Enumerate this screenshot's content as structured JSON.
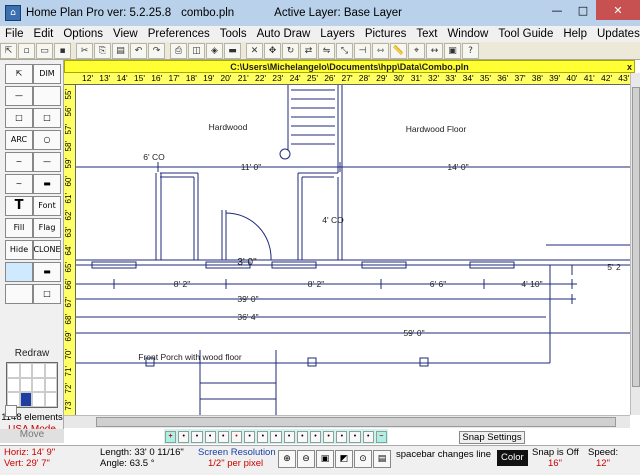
{
  "window": {
    "app_title": "Home Plan Pro ver: 5.2.25.8",
    "file_name": "combo.pln",
    "active_layer": "Active Layer: Base Layer",
    "minimize": "—",
    "maximize": "□",
    "close": "✕"
  },
  "menu": [
    "File",
    "Edit",
    "Options",
    "View",
    "Preferences",
    "Tools",
    "Auto Draw",
    "Layers",
    "Pictures",
    "Text",
    "Window",
    "Tool Guide",
    "Help",
    "Updates"
  ],
  "toolbar": {
    "icons": [
      "cursor-icon",
      "new-file-icon",
      "open-file-icon",
      "save-icon",
      "cut-icon",
      "copy-icon",
      "paste-icon",
      "undo-icon",
      "redo-icon",
      "print-icon",
      "zoom-window-icon",
      "zoom-extents-icon",
      "save-red-icon",
      "delete-icon",
      "move-icon",
      "rotate-icon",
      "flip-icon",
      "mirror-icon",
      "scale-icon",
      "extend-icon",
      "stretch-icon",
      "measure-icon",
      "snap-icon",
      "dimension-icon",
      "block-icon",
      "help-icon"
    ]
  },
  "path": "C:\\Users\\Michelangelo\\Documents\\hpp\\Data\\Combo.pln",
  "ruler_top": [
    "12'",
    "13'",
    "14'",
    "15'",
    "16'",
    "17'",
    "18'",
    "19'",
    "20'",
    "21'",
    "22'",
    "23'",
    "24'",
    "25'",
    "26'",
    "27'",
    "28'",
    "29'",
    "30'",
    "31'",
    "32'",
    "33'",
    "34'",
    "35'",
    "36'",
    "37'",
    "38'",
    "39'",
    "40'",
    "41'",
    "42'",
    "43'"
  ],
  "ruler_left": [
    "55'",
    "56'",
    "57'",
    "58'",
    "59'",
    "60'",
    "61'",
    "62'",
    "63'",
    "64'",
    "65'",
    "66'",
    "67'",
    "68'",
    "69'",
    "70'",
    "71'",
    "72'",
    "73'"
  ],
  "drawing": {
    "hardwood": "Hardwood",
    "hardwood_floor": "Hardwood Floor",
    "co_6": "6' CO",
    "dim_11": "11' 0\"",
    "dim_14": "14' 0\"",
    "co_4": "4' CO",
    "door_dim": "3' 0\"",
    "dim_8_2a": "8' 2\"",
    "dim_8_2b": "8' 2\"",
    "dim_6_6": "6' 6\"",
    "dim_4_10": "4' 10\"",
    "dim_5_2": "5' 2",
    "dim_39": "39' 0\"",
    "dim_36_4": "36' 4\"",
    "dim_59": "59' 0\"",
    "porch": "Front Porch with wood floor"
  },
  "lefttools": {
    "select": "⇱",
    "dim": "DIM",
    "line": "—",
    "rect": "□",
    "arc": "ARC",
    "circle": "○",
    "curve": "~",
    "blank": "",
    "text_t": "T",
    "font_t": "Font",
    "fill": "Fill",
    "fill_flag": "Flag",
    "hide": "Hide",
    "clone": "CLONE",
    "wall": "▬",
    "redraw": "Redraw",
    "element_count": "1148 elements",
    "usa_mode": "USA Mode"
  },
  "palette_colors": [
    "#ffffff",
    "#ffffff",
    "#ffffff",
    "#ffffff",
    "#ffffff",
    "#ffffff",
    "#ffffff",
    "#ffffff",
    "#ffffff",
    "#1f3fa0",
    "#ffffff",
    "#ffffff"
  ],
  "move": "Move",
  "nav": [
    "+",
    "•",
    "•",
    "•",
    "•",
    "•",
    "•",
    "•",
    "•",
    "•",
    "•",
    "•",
    "•",
    "•",
    "•",
    "•",
    "−"
  ],
  "snap_settings": "Snap Settings",
  "status": {
    "horiz": "Horiz: 14' 9\"",
    "vert": "Vert: 29' 7\"",
    "length": "Length: 33' 0 11/16\"",
    "angle": "Angle: 63.5 °",
    "res_label": "Screen Resolution",
    "res_value": "1/2\" per pixel",
    "spacebar": "spacebar changes line",
    "color": "Color",
    "snap_label": "Snap is Off",
    "snap_value": "16\"",
    "speed_label": "Speed:",
    "speed_value": "12\""
  },
  "colors": {
    "title_bg": "#b9d1ea",
    "path_bg": "#ffff33",
    "close_btn": "#c75050",
    "status_red": "#cc0000",
    "line_blue": "#1f2a7a"
  }
}
